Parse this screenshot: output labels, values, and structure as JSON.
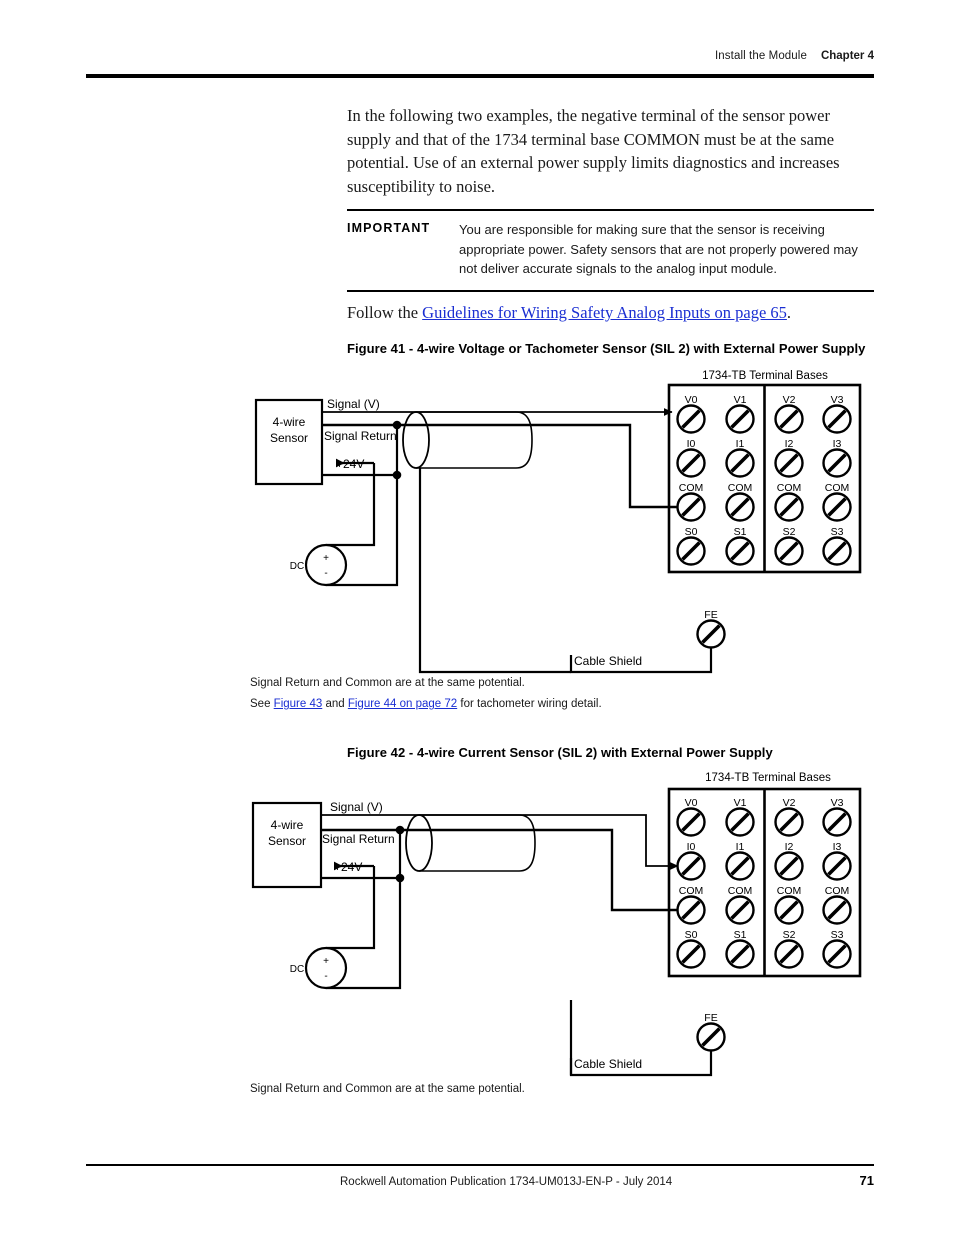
{
  "header": {
    "title": "Install the Module",
    "chapter": "Chapter 4"
  },
  "intro": "In the following two examples, the negative terminal of the sensor power supply and that of the 1734 terminal base COMMON must be at the same potential. Use of an external power supply limits diagnostics and increases susceptibility to noise.",
  "important": {
    "label": "IMPORTANT",
    "text": "You are responsible for making sure that the sensor is receiving appropriate power. Safety sensors that are not properly powered may not deliver accurate signals to the analog input module."
  },
  "follow": {
    "prefix": "Follow the ",
    "link": "Guidelines for Wiring Safety Analog Inputs on page 65",
    "suffix": "."
  },
  "figure41": {
    "caption": "Figure 41 - 4-wire Voltage or Tachometer Sensor (SIL 2) with External Power Supply",
    "terminal_header": "1734-TB Terminal Bases",
    "sensor_line1": "4-wire",
    "sensor_line2": "Sensor",
    "label_signal": "Signal (V)",
    "label_signal_return": "Signal Return",
    "label_24v": "+24V",
    "label_dc": "DC",
    "label_plus": "+",
    "label_minus": "-",
    "label_cable_shield": "Cable Shield",
    "label_fe": "FE",
    "terminals": [
      [
        "V0",
        "V1",
        "V2",
        "V3"
      ],
      [
        "I0",
        "I1",
        "I2",
        "I3"
      ],
      [
        "COM",
        "COM",
        "COM",
        "COM"
      ],
      [
        "S0",
        "S1",
        "S2",
        "S3"
      ]
    ],
    "notes": [
      "Signal Return and Common are at the same potential."
    ],
    "note_see_prefix": "See ",
    "note_link1": "Figure 43",
    "note_mid": " and ",
    "note_link2": "Figure 44 on page 72",
    "note_suffix": " for tachometer wiring detail."
  },
  "figure42": {
    "caption": "Figure 42 - 4-wire Current Sensor (SIL 2) with External Power Supply",
    "terminal_header": "1734-TB Terminal Bases",
    "sensor_line1": "4-wire",
    "sensor_line2": "Sensor",
    "label_signal": "Signal (V)",
    "label_signal_return": "Signal Return",
    "label_24v": "+24V",
    "label_dc": "DC",
    "label_plus": "+",
    "label_minus": "-",
    "label_cable_shield": "Cable Shield",
    "label_fe": "FE",
    "terminals": [
      [
        "V0",
        "V1",
        "V2",
        "V3"
      ],
      [
        "I0",
        "I1",
        "I2",
        "I3"
      ],
      [
        "COM",
        "COM",
        "COM",
        "COM"
      ],
      [
        "S0",
        "S1",
        "S2",
        "S3"
      ]
    ],
    "notes": [
      "Signal Return and Common are at the same potential."
    ]
  },
  "footer": {
    "text": "Rockwell Automation Publication 1734-UM013J-EN-P - July 2014",
    "page": "71"
  },
  "colors": {
    "link": "#1a2ed2",
    "rule": "#000000",
    "text": "#1a1a1a"
  }
}
